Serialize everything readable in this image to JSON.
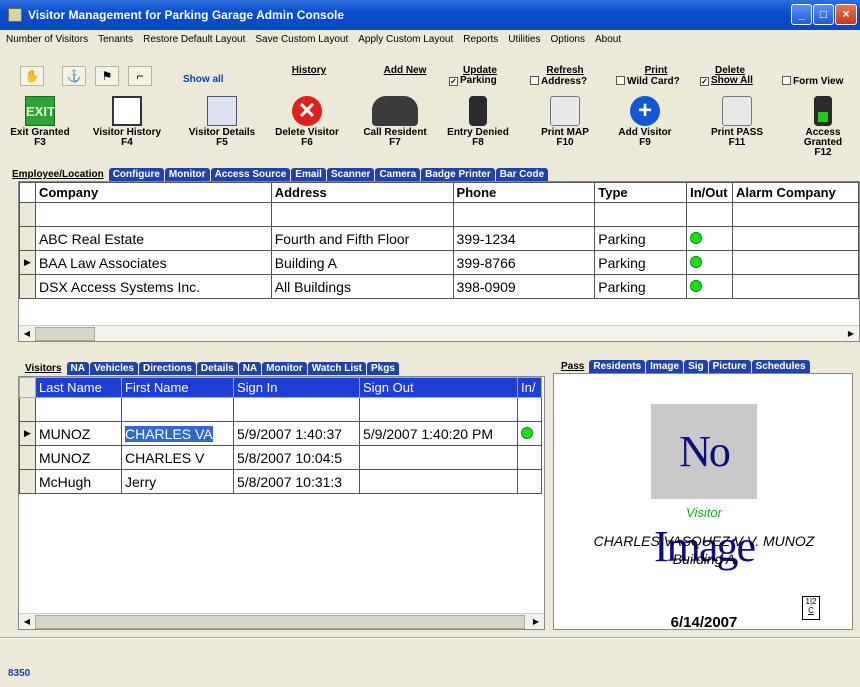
{
  "window": {
    "title": "Visitor Management for Parking Garage Admin Console"
  },
  "menu": [
    "Number of Visitors",
    "Tenants",
    "Restore Default Layout",
    "Save Custom Layout",
    "Apply Custom Layout",
    "Reports",
    "Utilities",
    "Options",
    "About"
  ],
  "small_toolbar": {
    "show_all": "Show all",
    "history": "History",
    "add_new": "Add New",
    "update": "Update",
    "parking": "Parking",
    "refresh": "Refresh",
    "address": "Address?",
    "print": "Print",
    "wild_card": "Wild Card?",
    "delete": "Delete",
    "show_all_check": "Show All",
    "form_view": "Form View"
  },
  "big_toolbar": [
    {
      "label": "Exit Granted",
      "key": "F3"
    },
    {
      "label": "Visitor History",
      "key": "F4"
    },
    {
      "label": "Visitor Details",
      "key": "F5"
    },
    {
      "label": "Delete Visitor",
      "key": "F6"
    },
    {
      "label": "Call Resident",
      "key": "F7"
    },
    {
      "label": "Entry Denied",
      "key": "F8"
    },
    {
      "label": "Print MAP",
      "key": "F10"
    },
    {
      "label": "Add Visitor",
      "key": "F9"
    },
    {
      "label": "Print PASS",
      "key": "F11"
    },
    {
      "label": "Access Granted",
      "key": "F12"
    }
  ],
  "top_tabs": [
    "Employee/Location",
    "Configure",
    "Monitor",
    "Access Source",
    "Email",
    "Scanner",
    "Camera",
    "Badge Printer",
    "Bar Code"
  ],
  "company_grid": {
    "headers": [
      "Company",
      "Address",
      "Phone",
      "Type",
      "In/Out",
      "Alarm Company"
    ],
    "rows": [
      [
        "ABC Real Estate",
        "Fourth and Fifth Floor",
        "399-1234",
        "Parking"
      ],
      [
        "BAA Law Associates",
        "Building A",
        "399-8766",
        "Parking"
      ],
      [
        "DSX Access Systems Inc.",
        "All Buildings",
        "398-0909",
        "Parking"
      ]
    ]
  },
  "visitor_tabs": [
    "Visitors",
    "NA",
    "Vehicles",
    "Directions",
    "Details",
    "NA",
    "Monitor",
    "Watch List",
    "Pkgs"
  ],
  "visitor_grid": {
    "headers": [
      "Last Name",
      "First Name",
      "Sign In",
      "Sign Out",
      "In/"
    ],
    "rows": [
      [
        "MUNOZ",
        "CHARLES VA",
        "5/9/2007 1:40:37",
        "5/9/2007 1:40:20 PM"
      ],
      [
        "MUNOZ",
        "CHARLES V",
        "5/8/2007 10:04:5",
        ""
      ],
      [
        "McHugh",
        "Jerry",
        "5/8/2007 10:31:3",
        ""
      ]
    ]
  },
  "pass_tabs": [
    "Pass",
    "Residents",
    "Image",
    "Sig",
    "Picture",
    "Schedules"
  ],
  "pass": {
    "image_text": "No Image",
    "type": "Visitor",
    "name": "CHARLES VASQUEZ V V. MUNOZ",
    "building": "Building A",
    "date": "6/14/2007",
    "cal_top": "1|2",
    "cal_bottom": "C"
  },
  "status": "8350",
  "colors": {
    "title_bar": "#0a4fd0",
    "tab": "#1f43a9",
    "grid_header": "#1e3ed6",
    "status_green": "#13e313"
  }
}
